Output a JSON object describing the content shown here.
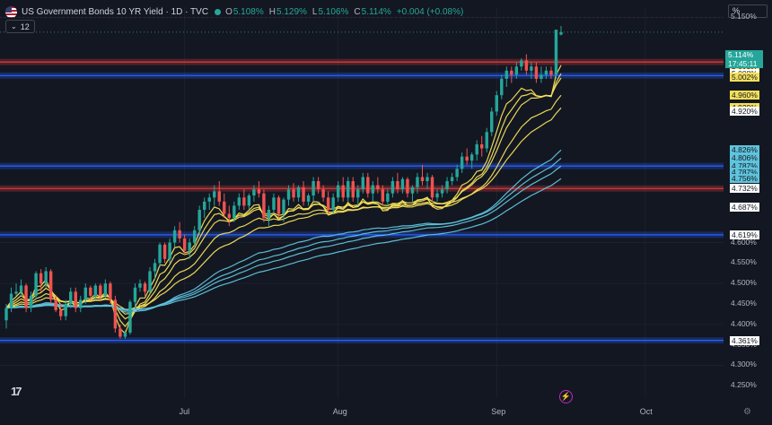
{
  "header": {
    "title": "US Government Bonds 10 YR Yield · 1D · TVC",
    "open_label": "O",
    "open_value": "5.108%",
    "high_label": "H",
    "high_value": "5.129%",
    "low_label": "L",
    "low_value": "5.106%",
    "close_label": "C",
    "close_value": "5.114%",
    "change": "+0.004 (+0.08%)",
    "indicators_count": "12",
    "scale_mode": "%"
  },
  "current": {
    "price": "5.114%",
    "countdown": "17:45:11"
  },
  "colors": {
    "up": "#26a69a",
    "down": "#ef5350",
    "bg": "#131722",
    "red_zone": "#d53a3a",
    "blue_zone": "#2962ff",
    "ema_fast": "#f5e05a",
    "ema_slow": "#5fc4dc"
  },
  "icons": {
    "flag": "us-flag-icon",
    "logo": "tradingview-logo-icon",
    "alert": "lightning-icon",
    "settings": "gear-icon"
  },
  "chart_data": {
    "type": "candlestick",
    "title": "US Government Bonds 10 YR Yield · 1D · TVC",
    "ylim": [
      4.22,
      5.175
    ],
    "y_unit": "%",
    "y_ticks": [
      "5.150%",
      "4.600%",
      "4.550%",
      "4.500%",
      "4.450%",
      "4.400%",
      "4.350%",
      "4.300%",
      "4.250%"
    ],
    "x_ticks": [
      {
        "label": "Jul",
        "day": 36
      },
      {
        "label": "Aug",
        "day": 67
      },
      {
        "label": "Sep",
        "day": 99
      },
      {
        "label": "Oct",
        "day": 129
      }
    ],
    "candles": [
      [
        4.41,
        4.45,
        4.39,
        4.44
      ],
      [
        4.44,
        4.49,
        4.43,
        4.475
      ],
      [
        4.475,
        4.5,
        4.47,
        4.48
      ],
      [
        4.48,
        4.51,
        4.47,
        4.495
      ],
      [
        4.495,
        4.5,
        4.43,
        4.44
      ],
      [
        4.44,
        4.48,
        4.43,
        4.47
      ],
      [
        4.47,
        4.53,
        4.46,
        4.525
      ],
      [
        4.525,
        4.535,
        4.48,
        4.5
      ],
      [
        4.5,
        4.54,
        4.49,
        4.53
      ],
      [
        4.53,
        4.535,
        4.45,
        4.46
      ],
      [
        4.46,
        4.47,
        4.43,
        4.435
      ],
      [
        4.435,
        4.45,
        4.41,
        4.42
      ],
      [
        4.42,
        4.46,
        4.41,
        4.45
      ],
      [
        4.45,
        4.49,
        4.44,
        4.48
      ],
      [
        4.48,
        4.49,
        4.43,
        4.44
      ],
      [
        4.44,
        4.47,
        4.43,
        4.46
      ],
      [
        4.46,
        4.5,
        4.45,
        4.49
      ],
      [
        4.49,
        4.495,
        4.46,
        4.47
      ],
      [
        4.47,
        4.5,
        4.46,
        4.495
      ],
      [
        4.495,
        4.5,
        4.46,
        4.47
      ],
      [
        4.47,
        4.51,
        4.465,
        4.5
      ],
      [
        4.5,
        4.505,
        4.45,
        4.46
      ],
      [
        4.46,
        4.47,
        4.38,
        4.39
      ],
      [
        4.39,
        4.4,
        4.365,
        4.37
      ],
      [
        4.37,
        4.385,
        4.365,
        4.38
      ],
      [
        4.38,
        4.46,
        4.375,
        4.455
      ],
      [
        4.455,
        4.5,
        4.44,
        4.49
      ],
      [
        4.49,
        4.51,
        4.48,
        4.5
      ],
      [
        4.5,
        4.505,
        4.47,
        4.48
      ],
      [
        4.48,
        4.54,
        4.475,
        4.53
      ],
      [
        4.53,
        4.56,
        4.51,
        4.55
      ],
      [
        4.55,
        4.6,
        4.54,
        4.595
      ],
      [
        4.595,
        4.6,
        4.55,
        4.56
      ],
      [
        4.56,
        4.61,
        4.55,
        4.6
      ],
      [
        4.6,
        4.64,
        4.59,
        4.63
      ],
      [
        4.63,
        4.65,
        4.6,
        4.61
      ],
      [
        4.61,
        4.62,
        4.57,
        4.58
      ],
      [
        4.58,
        4.61,
        4.56,
        4.6
      ],
      [
        4.6,
        4.64,
        4.59,
        4.63
      ],
      [
        4.63,
        4.69,
        4.62,
        4.68
      ],
      [
        4.68,
        4.71,
        4.66,
        4.7
      ],
      [
        4.7,
        4.72,
        4.68,
        4.71
      ],
      [
        4.71,
        4.74,
        4.69,
        4.725
      ],
      [
        4.725,
        4.75,
        4.69,
        4.7
      ],
      [
        4.7,
        4.72,
        4.66,
        4.67
      ],
      [
        4.67,
        4.69,
        4.64,
        4.66
      ],
      [
        4.66,
        4.7,
        4.65,
        4.69
      ],
      [
        4.69,
        4.72,
        4.68,
        4.71
      ],
      [
        4.71,
        4.73,
        4.68,
        4.69
      ],
      [
        4.69,
        4.72,
        4.68,
        4.715
      ],
      [
        4.715,
        4.74,
        4.7,
        4.73
      ],
      [
        4.73,
        4.75,
        4.71,
        4.72
      ],
      [
        4.72,
        4.73,
        4.65,
        4.66
      ],
      [
        4.66,
        4.69,
        4.64,
        4.68
      ],
      [
        4.68,
        4.72,
        4.67,
        4.71
      ],
      [
        4.71,
        4.715,
        4.66,
        4.67
      ],
      [
        4.67,
        4.71,
        4.65,
        4.705
      ],
      [
        4.705,
        4.74,
        4.69,
        4.73
      ],
      [
        4.73,
        4.745,
        4.7,
        4.71
      ],
      [
        4.71,
        4.74,
        4.7,
        4.735
      ],
      [
        4.735,
        4.75,
        4.69,
        4.7
      ],
      [
        4.7,
        4.72,
        4.69,
        4.715
      ],
      [
        4.715,
        4.76,
        4.7,
        4.75
      ],
      [
        4.75,
        4.76,
        4.72,
        4.73
      ],
      [
        4.73,
        4.74,
        4.7,
        4.71
      ],
      [
        4.71,
        4.725,
        4.67,
        4.68
      ],
      [
        4.68,
        4.72,
        4.67,
        4.71
      ],
      [
        4.71,
        4.75,
        4.7,
        4.74
      ],
      [
        4.74,
        4.76,
        4.7,
        4.71
      ],
      [
        4.71,
        4.76,
        4.7,
        4.75
      ],
      [
        4.75,
        4.76,
        4.7,
        4.71
      ],
      [
        4.71,
        4.74,
        4.69,
        4.73
      ],
      [
        4.73,
        4.77,
        4.72,
        4.76
      ],
      [
        4.76,
        4.77,
        4.71,
        4.72
      ],
      [
        4.72,
        4.75,
        4.7,
        4.74
      ],
      [
        4.74,
        4.76,
        4.72,
        4.73
      ],
      [
        4.73,
        4.74,
        4.69,
        4.7
      ],
      [
        4.7,
        4.73,
        4.69,
        4.72
      ],
      [
        4.72,
        4.76,
        4.71,
        4.75
      ],
      [
        4.75,
        4.77,
        4.72,
        4.73
      ],
      [
        4.73,
        4.76,
        4.72,
        4.755
      ],
      [
        4.755,
        4.76,
        4.71,
        4.72
      ],
      [
        4.72,
        4.74,
        4.7,
        4.735
      ],
      [
        4.735,
        4.77,
        4.72,
        4.76
      ],
      [
        4.76,
        4.79,
        4.74,
        4.75
      ],
      [
        4.75,
        4.77,
        4.73,
        4.76
      ],
      [
        4.76,
        4.765,
        4.7,
        4.71
      ],
      [
        4.71,
        4.73,
        4.7,
        4.72
      ],
      [
        4.72,
        4.74,
        4.71,
        4.73
      ],
      [
        4.73,
        4.76,
        4.72,
        4.75
      ],
      [
        4.75,
        4.77,
        4.74,
        4.76
      ],
      [
        4.76,
        4.79,
        4.75,
        4.78
      ],
      [
        4.78,
        4.82,
        4.77,
        4.81
      ],
      [
        4.81,
        4.83,
        4.79,
        4.8
      ],
      [
        4.8,
        4.82,
        4.78,
        4.815
      ],
      [
        4.815,
        4.85,
        4.8,
        4.84
      ],
      [
        4.84,
        4.86,
        4.81,
        4.83
      ],
      [
        4.83,
        4.88,
        4.82,
        4.87
      ],
      [
        4.87,
        4.93,
        4.86,
        4.92
      ],
      [
        4.92,
        4.97,
        4.91,
        4.96
      ],
      [
        4.96,
        5.01,
        4.95,
        5.0
      ],
      [
        5.0,
        5.03,
        4.98,
        5.02
      ],
      [
        5.02,
        5.03,
        4.99,
        5.01
      ],
      [
        5.01,
        5.04,
        5.0,
        5.03
      ],
      [
        5.03,
        5.05,
        5.02,
        5.045
      ],
      [
        5.045,
        5.06,
        5.01,
        5.02
      ],
      [
        5.02,
        5.04,
        5.0,
        5.03
      ],
      [
        5.03,
        5.04,
        4.99,
        5.0
      ],
      [
        5.0,
        5.03,
        4.99,
        5.01
      ],
      [
        5.01,
        5.03,
        5.0,
        5.02
      ],
      [
        5.02,
        5.03,
        5.0,
        5.01
      ],
      [
        5.01,
        5.1,
        5.0,
        5.12
      ],
      [
        5.108,
        5.129,
        5.106,
        5.114
      ]
    ],
    "moving_averages": [
      {
        "name": "MA1",
        "color": "#f5e05a",
        "last": 5.033
      },
      {
        "name": "MA2",
        "color": "#f5e05a",
        "last": 5.013
      },
      {
        "name": "MA3",
        "color": "#f5e05a",
        "last": 5.002
      },
      {
        "name": "MA4",
        "color": "#f5e05a",
        "last": 4.96
      },
      {
        "name": "MA5",
        "color": "#f5e05a",
        "last": 4.929
      },
      {
        "name": "MA6",
        "color": "#5fc4dc",
        "last": 4.826
      },
      {
        "name": "MA7",
        "color": "#5fc4dc",
        "last": 4.806
      },
      {
        "name": "MA8",
        "color": "#5fc4dc",
        "last": 4.787
      },
      {
        "name": "MA9",
        "color": "#5fc4dc",
        "last": 4.756
      }
    ],
    "zones": [
      {
        "type": "resistance",
        "value": 5.041
      },
      {
        "type": "resistance",
        "value": 4.732
      },
      {
        "type": "support",
        "value": 5.008
      },
      {
        "type": "support",
        "value": 4.787
      },
      {
        "type": "support",
        "value": 4.619
      },
      {
        "type": "support",
        "value": 4.361
      }
    ],
    "price_tags": [
      {
        "label": "5.041%",
        "value": 5.041,
        "style": "white"
      },
      {
        "label": "5.041%",
        "value": 5.035,
        "style": "white"
      },
      {
        "label": "5.033%",
        "value": 5.028,
        "style": "yellow"
      },
      {
        "label": "5.013%",
        "value": 5.02,
        "style": "yellow"
      },
      {
        "label": "5.008%",
        "value": 5.012,
        "style": "white"
      },
      {
        "label": "5.002%",
        "value": 5.004,
        "style": "yellow"
      },
      {
        "label": "4.960%",
        "value": 4.96,
        "style": "yellow"
      },
      {
        "label": "4.929%",
        "value": 4.929,
        "style": "yellow"
      },
      {
        "label": "4.920%",
        "value": 4.92,
        "style": "white"
      },
      {
        "label": "4.826%",
        "value": 4.826,
        "style": "blue"
      },
      {
        "label": "4.806%",
        "value": 4.806,
        "style": "blue"
      },
      {
        "label": "4.787%",
        "value": 4.787,
        "style": "blue"
      },
      {
        "label": "4.787%",
        "value": 4.771,
        "style": "blue"
      },
      {
        "label": "4.756%",
        "value": 4.756,
        "style": "blue"
      },
      {
        "label": "4.732%",
        "value": 4.732,
        "style": "white"
      },
      {
        "label": "4.687%",
        "value": 4.687,
        "style": "white"
      },
      {
        "label": "4.619%",
        "value": 4.619,
        "style": "white"
      },
      {
        "label": "4.361%",
        "value": 4.361,
        "style": "white"
      }
    ]
  }
}
